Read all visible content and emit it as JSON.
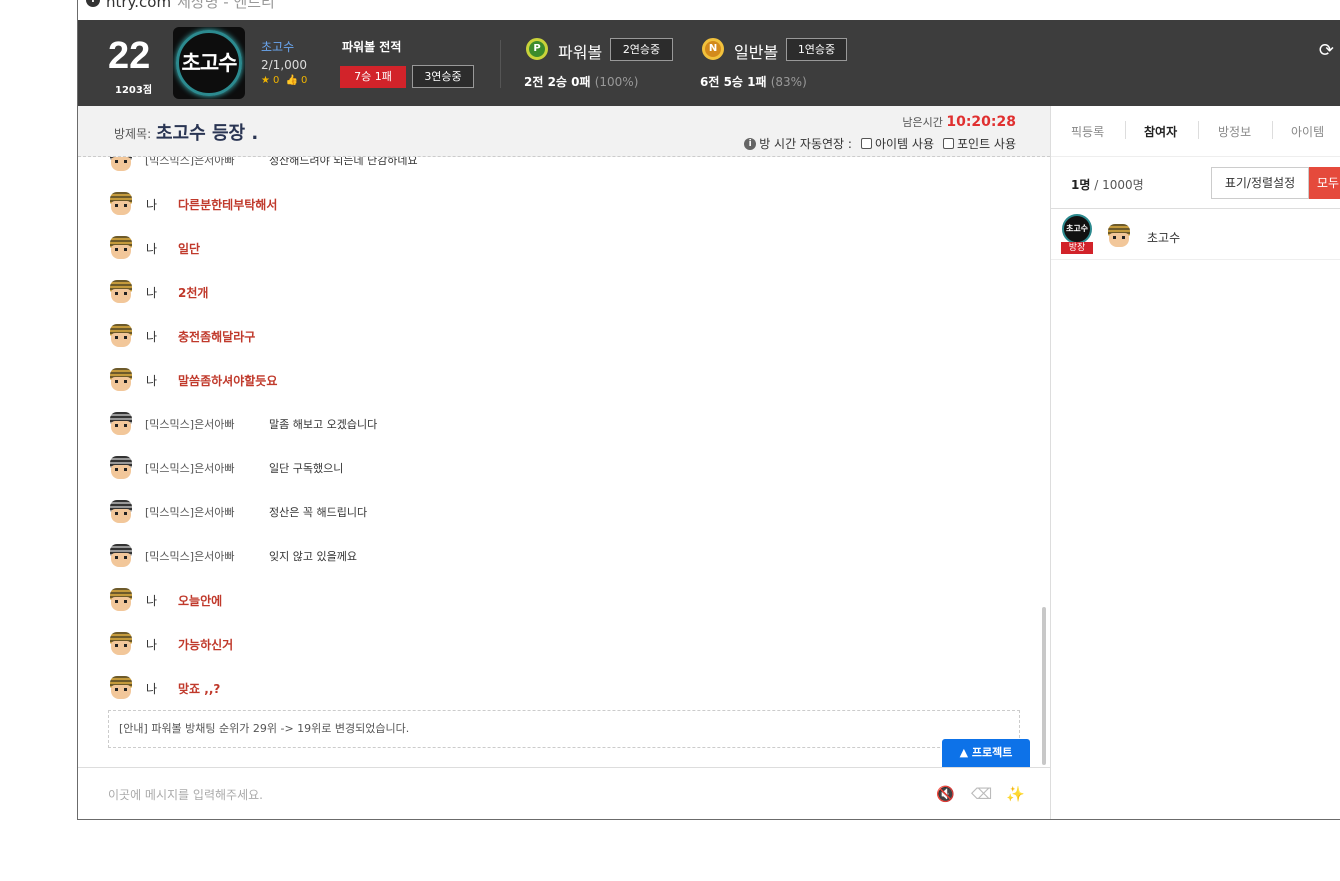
{
  "browser": {
    "url": "ntry.com",
    "page_title": "세상명 - 엔트리"
  },
  "header": {
    "level": "22",
    "points": "1203점",
    "avatar_text": "초고수",
    "user_name": "초고수",
    "user_count": "2/1,000",
    "star_count": "0",
    "like_count": "0",
    "record_title": "파워볼 전적",
    "record_result": "7승 1패",
    "record_streak": "3연승중",
    "powerball": {
      "label": "파워볼",
      "streak": "2연승중",
      "stat": "2전 2승 0패",
      "pct": "(100%)"
    },
    "normalball": {
      "label": "일반볼",
      "streak": "1연승중",
      "stat": "6전 5승 1패",
      "pct": "(83%)"
    }
  },
  "room": {
    "label": "방제목:",
    "title": "초고수 등장 .",
    "remaining_label": "남은시간",
    "remaining_time": "10:20:28",
    "auto_extend_label": "방 시간 자동연장 :",
    "item_use_label": "아이템 사용",
    "point_use_label": "포인트 사용"
  },
  "chat": {
    "messages": [
      {
        "who": "other",
        "nick": "[믹스믹스]은서아빠",
        "text": "정산해드려야 되는데 난감하네요"
      },
      {
        "who": "me",
        "nick": "나",
        "text": "다른분한테부탁해서"
      },
      {
        "who": "me",
        "nick": "나",
        "text": "일단"
      },
      {
        "who": "me",
        "nick": "나",
        "text": "2천개"
      },
      {
        "who": "me",
        "nick": "나",
        "text": "충전좀해달라구"
      },
      {
        "who": "me",
        "nick": "나",
        "text": "말씀좀하셔야할듯요"
      },
      {
        "who": "other",
        "nick": "[믹스믹스]은서아빠",
        "text": "말좀 해보고 오겠습니다"
      },
      {
        "who": "other",
        "nick": "[믹스믹스]은서아빠",
        "text": "일단 구독했으니"
      },
      {
        "who": "other",
        "nick": "[믹스믹스]은서아빠",
        "text": "정산은 꼭 해드립니다"
      },
      {
        "who": "other",
        "nick": "[믹스믹스]은서아빠",
        "text": "잊지 않고 있을께요"
      },
      {
        "who": "me",
        "nick": "나",
        "text": "오늘안에"
      },
      {
        "who": "me",
        "nick": "나",
        "text": "가능하신거"
      },
      {
        "who": "me",
        "nick": "나",
        "text": "맞죠 ,,?"
      }
    ],
    "notice": "[안내] 파워볼 방채팅 순위가 29위 -> 19위로 변경되었습니다.",
    "project_button": "▲ 프로젝트",
    "input_placeholder": "이곳에 메시지를 입력해주세요."
  },
  "side": {
    "tabs": [
      "픽등록",
      "참여자",
      "방정보",
      "아이템"
    ],
    "active_tab": "참여자",
    "count_current": "1명",
    "count_total": "/ 1000명",
    "sort_button": "표기/정렬설정",
    "all_button": "모두",
    "members": [
      {
        "name": "초고수",
        "badge": "방장",
        "avatar_text": "초고수"
      }
    ]
  },
  "colors": {
    "accent_red": "#d2232a",
    "header_bg": "#3d3d3d",
    "link_blue": "#6aa6f0",
    "project_blue": "#0d72e8"
  }
}
